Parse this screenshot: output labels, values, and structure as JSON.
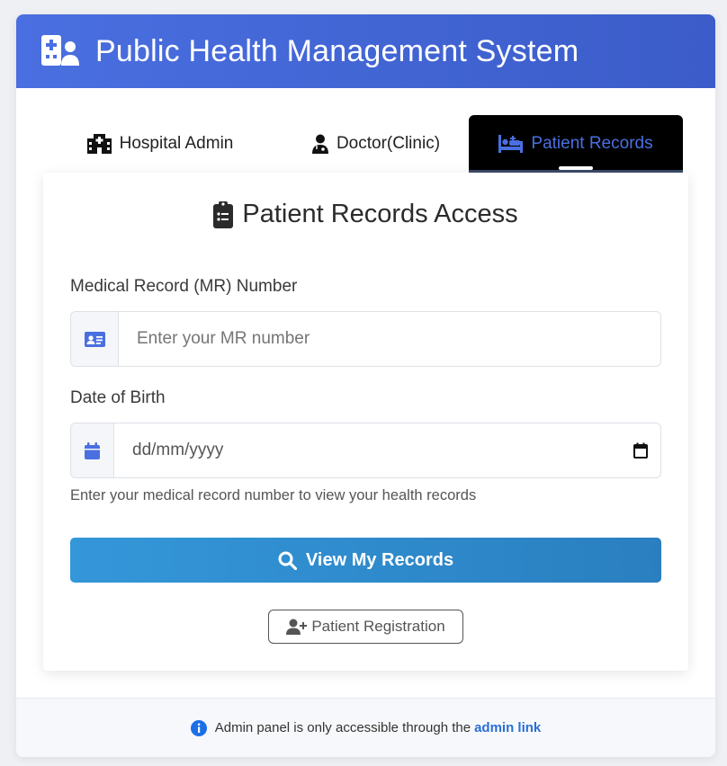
{
  "header": {
    "title": "Public Health Management System",
    "icon": "hospital-user-icon",
    "gradient_start": "#4a6fe0",
    "gradient_end": "#3b5cc9"
  },
  "tabs": [
    {
      "label": "Hospital Admin",
      "icon": "hospital-icon",
      "active": false
    },
    {
      "label": "Doctor(Clinic)",
      "icon": "user-doctor-icon",
      "active": false
    },
    {
      "label": "Patient Records",
      "icon": "bed-patient-icon",
      "active": true
    }
  ],
  "panel": {
    "title": "Patient Records Access",
    "title_icon": "clipboard-list-icon",
    "mr_label": "Medical Record (MR) Number",
    "mr_placeholder": "Enter your MR number",
    "mr_icon": "id-card-icon",
    "dob_label": "Date of Birth",
    "dob_placeholder": "dd/mm/yyyy",
    "dob_icon": "calendar-icon",
    "hint": "Enter your medical record number to view your health records",
    "submit_label": "View My Records",
    "submit_icon": "search-icon",
    "register_label": "Patient Registration",
    "register_icon": "user-plus-icon"
  },
  "footer": {
    "text": "Admin panel is only accessible through the",
    "link_text": "admin link",
    "icon": "info-circle-icon"
  },
  "colors": {
    "accent": "#4a6fe0",
    "button": "#3497d9",
    "link": "#2a6fd6",
    "active_tab_bg": "#000000"
  }
}
